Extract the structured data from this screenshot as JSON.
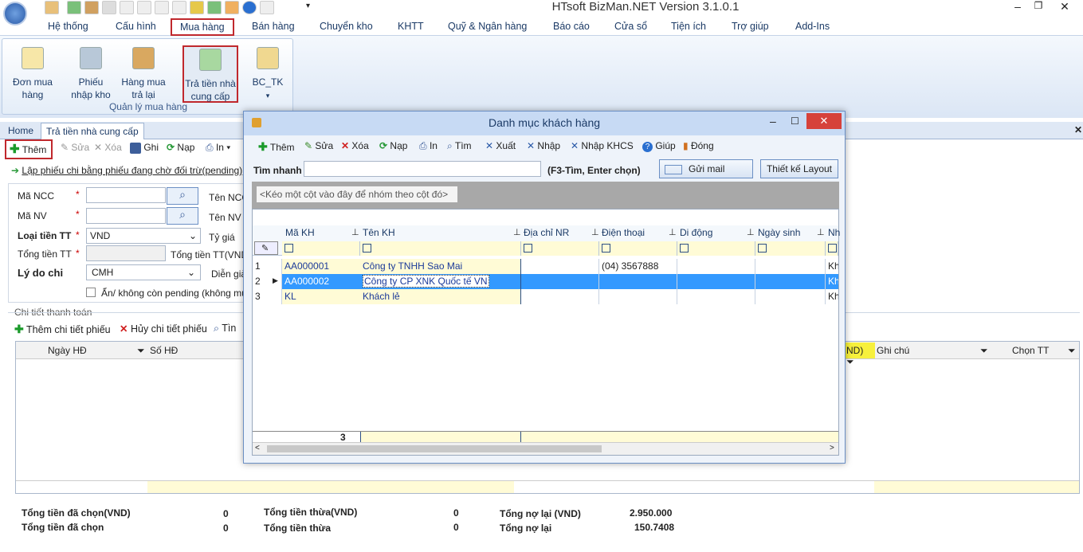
{
  "app": {
    "title": "HTsoft BizMan.NET Version 3.1.0.1"
  },
  "menu": [
    "Hệ thống",
    "Cấu hình",
    "Mua hàng",
    "Bán hàng",
    "Chuyển kho",
    "KHTT",
    "Quỹ & Ngân hàng",
    "Báo cáo",
    "Cửa sổ",
    "Tiện ích",
    "Trợ giúp",
    "Add-Ins"
  ],
  "ribbon": {
    "group_label": "Quản lý mua hàng",
    "buttons": [
      {
        "label1": "Đơn mua",
        "label2": "hàng"
      },
      {
        "label1": "Phiếu",
        "label2": "nhập kho"
      },
      {
        "label1": "Hàng mua",
        "label2": "trả lại"
      },
      {
        "label1": "Trả tiền nhà",
        "label2": "cung cấp"
      },
      {
        "label1": "BC_TK",
        "label2": "▾"
      }
    ]
  },
  "tabs": {
    "home": "Home",
    "active": "Trả tiền nhà cung cấp"
  },
  "toolbar": {
    "them": "Thêm",
    "sua": "Sửa",
    "xoa": "Xóa",
    "ghi": "Ghi",
    "nap": "Nạp",
    "in": "In"
  },
  "form": {
    "link": "Lập phiếu chi bằng phiếu đang chờ đối trừ(pending)",
    "ma_ncc": "Mã NCC",
    "ma_nv": "Mã NV",
    "loai_tien": "Loại tiền TT",
    "loai_tien_val": "VND",
    "tong_tien": "Tổng tiền TT",
    "ly_do": "Lý do chi",
    "ly_do_val": "CMH",
    "ten_ncc": "Tên NCC",
    "ten_nv": "Tên NV",
    "ty_gia": "Tỷ giá",
    "tong_tien_vnd": "Tổng tiền TT(VND)",
    "dien_giai": "Diễn giả",
    "an_pending": "Ẩn/ không còn pending (không muốn",
    "chi_tiet": "Chi tiết thanh toán",
    "them_ct": "Thêm chi tiết phiếu",
    "huy_ct": "Hủy chi tiết phiếu",
    "tim": "Tìn"
  },
  "detail_grid": {
    "cols": [
      "Ngày HĐ",
      "Số HĐ",
      "ND)",
      "Ghi chú",
      "Chọn TT"
    ]
  },
  "totals": {
    "l1": "Tổng tiền đã chọn(VND)",
    "v1": "0",
    "l2": "Tổng tiền đã chọn",
    "v2": "0",
    "l3": "Tổng tiền thừa(VND)",
    "v3": "0",
    "l4": "Tổng tiền thừa",
    "v4": "0",
    "l5": "Tổng nợ lại (VND)",
    "v5": "2.950.000",
    "l6": "Tổng nợ lại",
    "v6": "150.7408"
  },
  "dialog": {
    "title": "Danh mục khách hàng",
    "toolbar": [
      "Thêm",
      "Sửa",
      "Xóa",
      "Nạp",
      "In",
      "Tìm",
      "Xuất",
      "Nhập",
      "Nhập KHCS",
      "Giúp",
      "Đóng"
    ],
    "tim_nhanh": "Tìm nhanh",
    "hint": "(F3-Tìm, Enter chọn)",
    "gui_mail": "Gửi mail",
    "thiet_ke": "Thiết kế Layout",
    "group_hint": "<Kéo một cột vào đây để nhóm theo cột đó>",
    "columns": [
      "Mã KH",
      "Tên KH",
      "Địa chỉ NR",
      "Điện thoại",
      "Di động",
      "Ngày sinh",
      "Nh"
    ],
    "rows": [
      {
        "n": "1",
        "ma": "AA000001",
        "ten": "Công ty TNHH Sao Mai",
        "dt": "(04) 3567888",
        "nh": "Kh"
      },
      {
        "n": "2",
        "ma": "AA000002",
        "ten": "Công ty CP XNK Quốc tế VN",
        "dt": "",
        "nh": "Kh"
      },
      {
        "n": "3",
        "ma": "KL",
        "ten": "Khách lẻ",
        "dt": "",
        "nh": "Kh"
      }
    ],
    "count": "3"
  }
}
